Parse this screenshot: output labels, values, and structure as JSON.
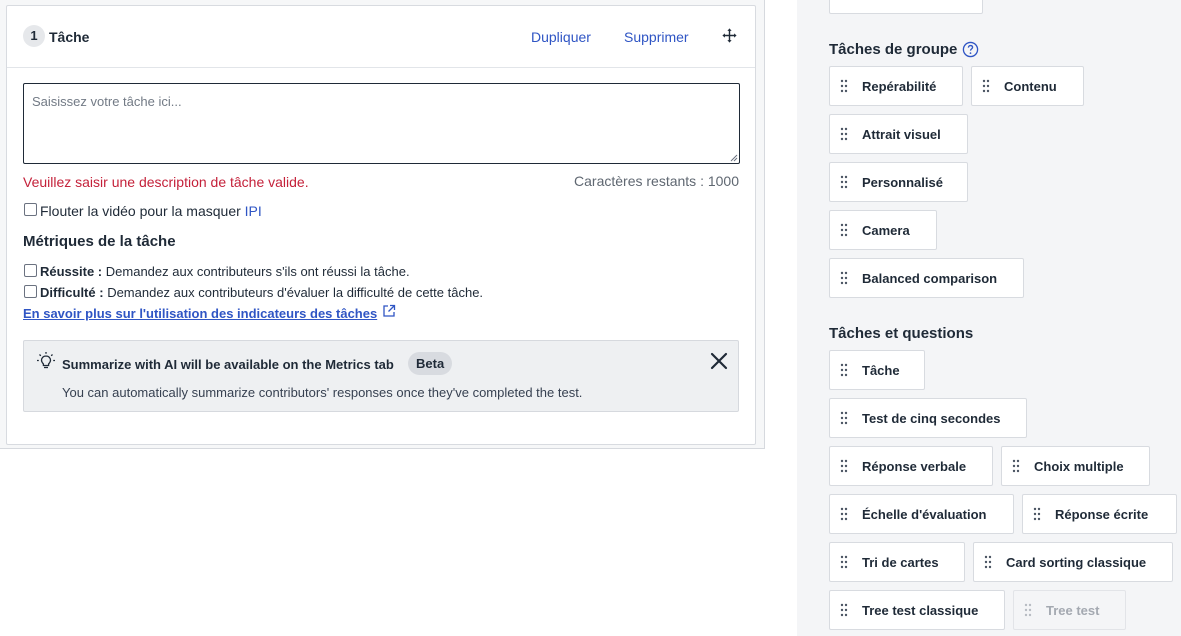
{
  "task_card": {
    "step_number": "1",
    "title": "Tâche",
    "duplicate_label": "Dupliquer",
    "delete_label": "Supprimer",
    "textarea_placeholder": "Saisissez votre tâche ici...",
    "textarea_value": "",
    "error_message": "Veuillez saisir une description de tâche valide.",
    "char_count": "Caractères restants : 1000",
    "blur_label": "Flouter la vidéo pour la masquer",
    "blur_link": "IPI",
    "metrics_title": "Métriques de la tâche",
    "metric_success_label": "Réussite :",
    "metric_success_desc": "Demandez aux contributeurs s'ils ont réussi la tâche.",
    "metric_difficulty_label": "Difficulté :",
    "metric_difficulty_desc": "Demandez aux contributeurs d'évaluer la difficulté de cette tâche.",
    "learn_more_link": "En savoir plus sur l'utilisation des indicateurs des tâches",
    "ai_banner": {
      "title": "Summarize with AI will be available on the Metrics tab",
      "badge": "Beta",
      "description": "You can automatically summarize contributors' responses once they've completed the test."
    }
  },
  "sidebar": {
    "group_tasks_title": "Tâches de groupe",
    "group_tasks": [
      "Repérabilité",
      "Contenu",
      "Attrait visuel",
      "Personnalisé",
      "Camera",
      "Balanced comparison"
    ],
    "tasks_questions_title": "Tâches et questions",
    "tasks_questions": [
      "Tâche",
      "Test de cinq secondes",
      "Réponse verbale",
      "Choix multiple",
      "Échelle d'évaluation",
      "Réponse écrite",
      "Tri de cartes",
      "Card sorting classique",
      "Tree test classique",
      "Tree test"
    ],
    "disabled_item": "Tree test"
  },
  "colors": {
    "link": "#2f55c4",
    "error": "#c4213a",
    "sidebar_bg": "#f4f5f7"
  }
}
